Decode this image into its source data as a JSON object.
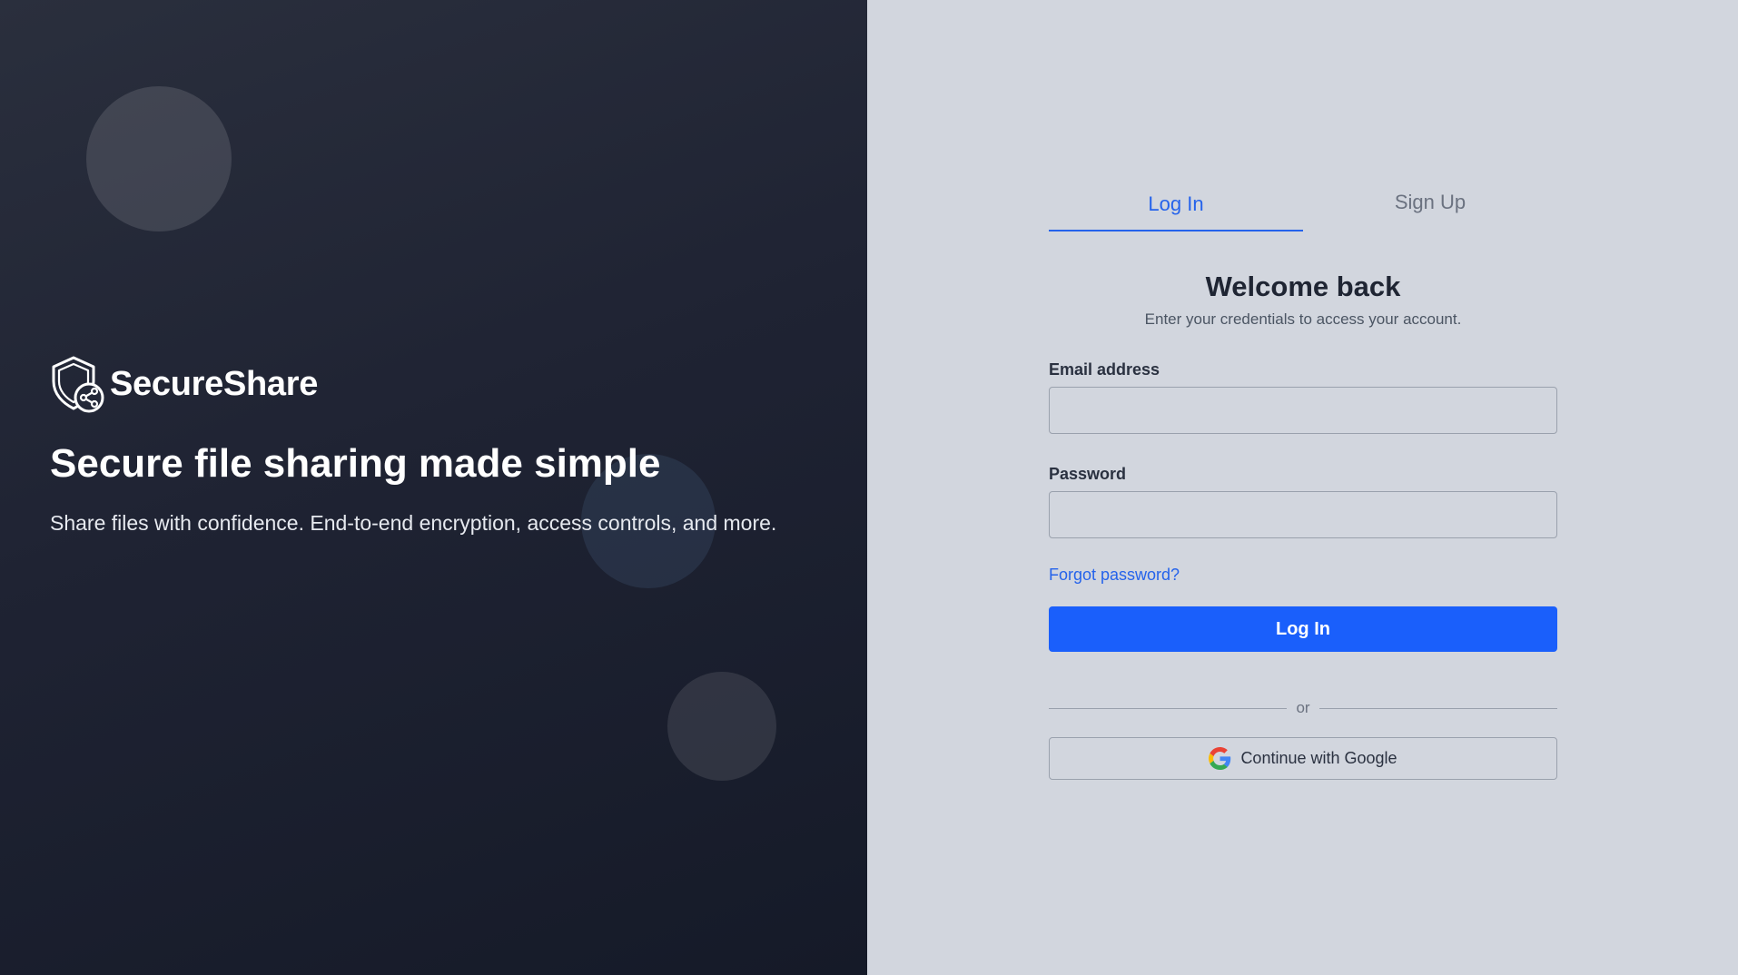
{
  "brand": {
    "name": "SecureShare",
    "icon": "shield-share-icon"
  },
  "hero": {
    "headline": "Secure file sharing made simple",
    "tagline": "Share files with confidence. End-to-end encryption, access controls, and more."
  },
  "tabs": [
    {
      "label": "Log In",
      "active": true
    },
    {
      "label": "Sign Up",
      "active": false
    }
  ],
  "form": {
    "title": "Welcome back",
    "subtitle": "Enter your credentials to access your account.",
    "email_label": "Email address",
    "email_value": "",
    "password_label": "Password",
    "password_value": "",
    "forgot_link": "Forgot password?",
    "submit_label": "Log In",
    "divider_text": "or",
    "google_label": "Continue with Google",
    "google_icon": "google-icon"
  },
  "colors": {
    "accent": "#1a5ffb",
    "link": "#2563eb",
    "left_panel_bg": "#1f2333",
    "right_panel_bg": "#d2d6de"
  }
}
